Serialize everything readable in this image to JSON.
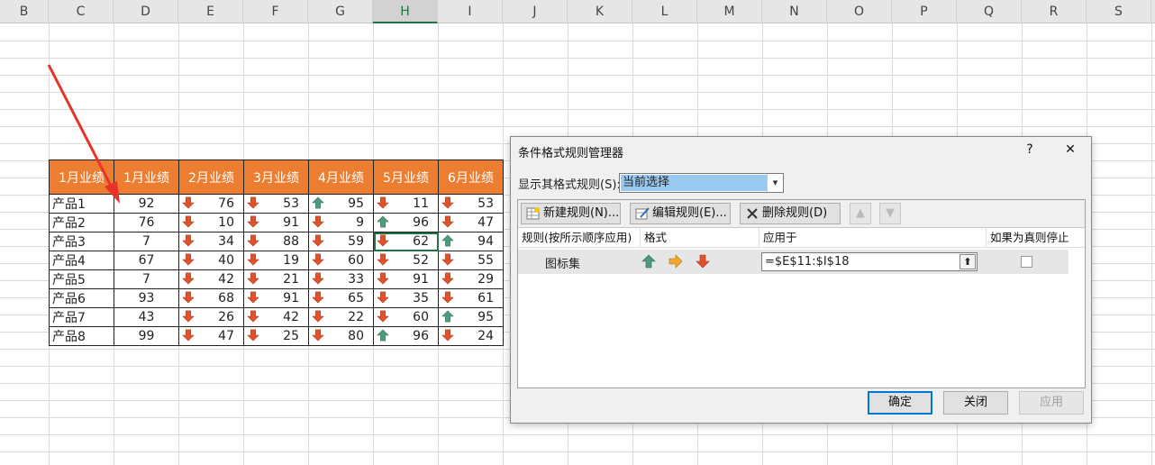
{
  "spreadsheet": {
    "columns": [
      "B",
      "C",
      "D",
      "E",
      "F",
      "G",
      "H",
      "I",
      "J",
      "K",
      "L",
      "M",
      "N",
      "O",
      "P",
      "Q",
      "R",
      "S"
    ],
    "active_column": "H",
    "table": {
      "headers": [
        "1月业绩",
        "1月业绩",
        "2月业绩",
        "3月业绩",
        "4月业绩",
        "5月业绩",
        "6月业绩"
      ],
      "rows": [
        {
          "name": "产品1",
          "d": "92",
          "v": [
            {
              "n": "76",
              "i": "down"
            },
            {
              "n": "53",
              "i": "down"
            },
            {
              "n": "95",
              "i": "up"
            },
            {
              "n": "11",
              "i": "down"
            },
            {
              "n": "53",
              "i": "down"
            }
          ]
        },
        {
          "name": "产品2",
          "d": "76",
          "v": [
            {
              "n": "10",
              "i": "down"
            },
            {
              "n": "91",
              "i": "down"
            },
            {
              "n": "9",
              "i": "down"
            },
            {
              "n": "96",
              "i": "up"
            },
            {
              "n": "47",
              "i": "down"
            }
          ]
        },
        {
          "name": "产品3",
          "d": "7",
          "v": [
            {
              "n": "34",
              "i": "down"
            },
            {
              "n": "88",
              "i": "down"
            },
            {
              "n": "59",
              "i": "down"
            },
            {
              "n": "62",
              "i": "down"
            },
            {
              "n": "94",
              "i": "up"
            }
          ]
        },
        {
          "name": "产品4",
          "d": "67",
          "v": [
            {
              "n": "40",
              "i": "down"
            },
            {
              "n": "19",
              "i": "down"
            },
            {
              "n": "60",
              "i": "down"
            },
            {
              "n": "52",
              "i": "down"
            },
            {
              "n": "55",
              "i": "down"
            }
          ]
        },
        {
          "name": "产品5",
          "d": "7",
          "v": [
            {
              "n": "42",
              "i": "down"
            },
            {
              "n": "21",
              "i": "down"
            },
            {
              "n": "33",
              "i": "down"
            },
            {
              "n": "91",
              "i": "down"
            },
            {
              "n": "29",
              "i": "down"
            }
          ]
        },
        {
          "name": "产品6",
          "d": "93",
          "v": [
            {
              "n": "68",
              "i": "down"
            },
            {
              "n": "91",
              "i": "down"
            },
            {
              "n": "65",
              "i": "down"
            },
            {
              "n": "35",
              "i": "down"
            },
            {
              "n": "61",
              "i": "down"
            }
          ]
        },
        {
          "name": "产品7",
          "d": "43",
          "v": [
            {
              "n": "26",
              "i": "down"
            },
            {
              "n": "42",
              "i": "down"
            },
            {
              "n": "22",
              "i": "down"
            },
            {
              "n": "60",
              "i": "down"
            },
            {
              "n": "95",
              "i": "up"
            }
          ]
        },
        {
          "name": "产品8",
          "d": "99",
          "v": [
            {
              "n": "47",
              "i": "down"
            },
            {
              "n": "25",
              "i": "down"
            },
            {
              "n": "80",
              "i": "down"
            },
            {
              "n": "96",
              "i": "up"
            },
            {
              "n": "24",
              "i": "down"
            }
          ]
        }
      ]
    }
  },
  "dialog": {
    "title": "条件格式规则管理器",
    "help": "?",
    "close": "✕",
    "show_rules_label": "显示其格式规则(S):",
    "show_rules_value": "当前选择",
    "toolbar": {
      "new_rule": "新建规则(N)...",
      "edit_rule": "编辑规则(E)...",
      "delete_rule": "删除规则(D)"
    },
    "columns": {
      "rule": "规则(按所示顺序应用)",
      "format": "格式",
      "applies_to": "应用于",
      "stop_if_true": "如果为真则停止"
    },
    "rule": {
      "type": "图标集",
      "applies_to": "=$E$11:$I$18"
    },
    "buttons": {
      "ok": "确定",
      "close": "关闭",
      "apply": "应用"
    }
  },
  "colors": {
    "header_orange": "#ed7d31",
    "icon_up": "#4e9b7b",
    "icon_side": "#f0a830",
    "icon_down": "#e0522a",
    "selection_blue": "#99c9ef",
    "annotation_red": "#e8332a"
  }
}
